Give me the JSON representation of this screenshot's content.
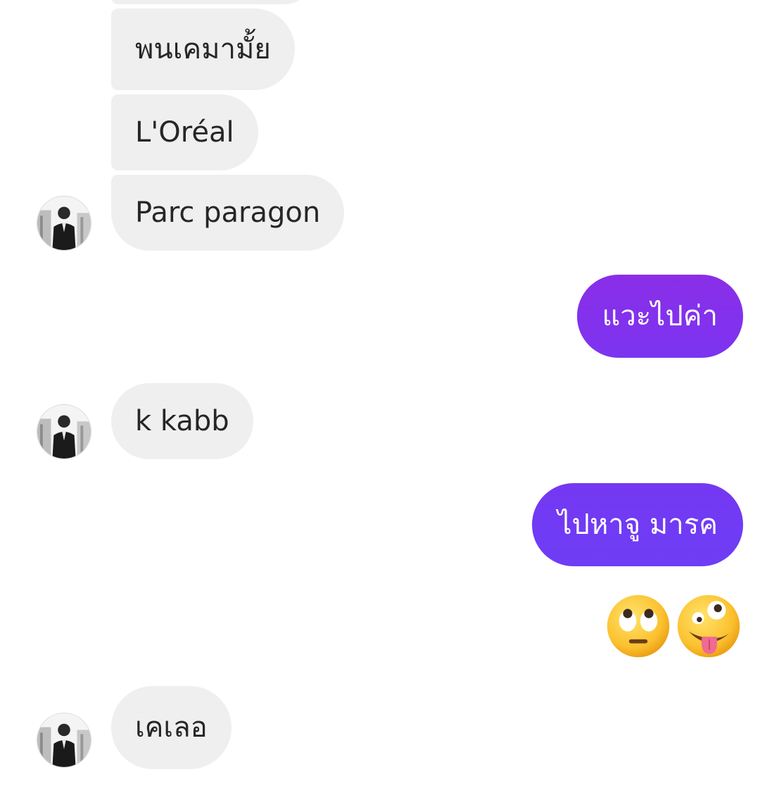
{
  "thread": {
    "incoming": [
      {
        "text": "พนเคมามั้ย"
      },
      {
        "text": "L'Oréal"
      },
      {
        "text": "Parc paragon"
      },
      {
        "text": "k kabb"
      },
      {
        "text": "เคเลอ"
      }
    ],
    "outgoing": [
      {
        "text": "แวะไปค่า"
      },
      {
        "text": "ไปหาจู มารค"
      }
    ],
    "reaction_emojis": [
      "face-with-rolling-eyes",
      "zany-face"
    ]
  },
  "colors": {
    "incoming_bubble": "#efefef",
    "incoming_text": "#262626",
    "outgoing_text": "#ffffff",
    "outgoing_gradient_top": "#8a2ee8",
    "outgoing_gradient_bottom": "#6e3df5"
  },
  "icons": {
    "avatar": "avatar-photo-icon",
    "emoji_1": "rolling-eyes-emoji-icon",
    "emoji_2": "zany-face-emoji-icon"
  }
}
